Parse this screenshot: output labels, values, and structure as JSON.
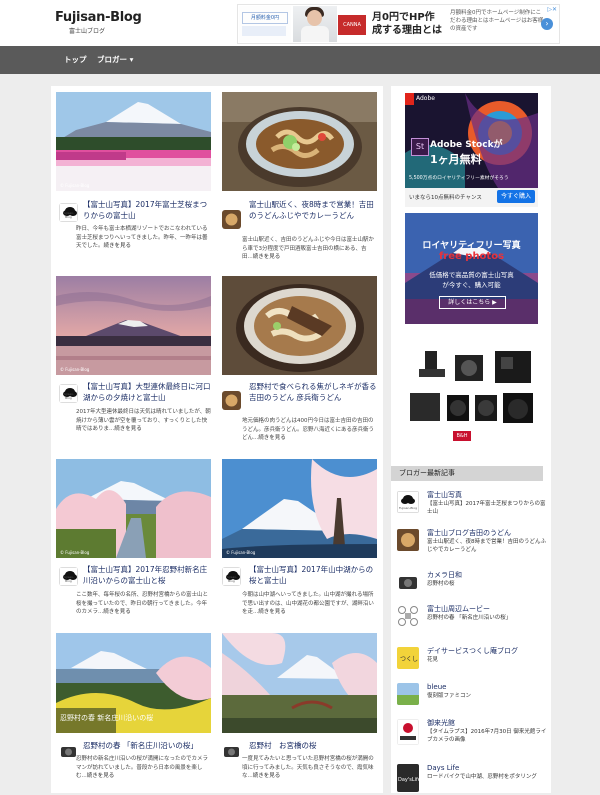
{
  "header": {
    "logo_title": "Fujisan-Blog",
    "logo_sub": "富士山ブログ",
    "ad": {
      "banner_small_label": "月額料金0円",
      "badge": "CANNA",
      "headline": "月0円でHP作成する理由とは",
      "body": "月額料金0円でホームページ制作にこだわる理由とはホームページはお客様の資産です"
    }
  },
  "nav": {
    "items": [
      {
        "label": "トップ"
      },
      {
        "label": "ブロガー ▾"
      }
    ]
  },
  "posts": [
    {
      "title": "【富士山写真】2017年富士芝桜まつりからの富士山",
      "excerpt": "昨日、今年も富士本栖湖リゾートでおこなわれている富士芝桜まつりへいってきました。昨年、一昨年は曇天でした。",
      "more": "続きを見る",
      "watermark": "© Fujisan-Blog"
    },
    {
      "title": "富士山駅近く、夜8時まで営業！吉田のうどんふじやでカレーうどん",
      "excerpt": "富士山駅近く、吉田のうどんふじや今日は富士山駅から車で3分程度で戸田酒販富士吉田の横にある、吉田...",
      "more": "続きを見る",
      "watermark": ""
    },
    {
      "title": "【富士山写真】大型連休最終日に河口湖からの夕焼けと富士山",
      "excerpt": "2017年大型連休最終日は天気は晴れていましたが、朝焼けから薄い雲が空を覆っており、すっくりとした快晴ではありま...",
      "more": "続きを見る",
      "watermark": "© Fujisan-Blog"
    },
    {
      "title": "忍野村で食べられる焦がしネギが香る吉田のうどん 彦兵衛うどん",
      "excerpt": "地元価格の肉うどんは400円今日は富士吉田の吉田のうどん。彦兵衛うどん。忍野八海近くにある彦兵衛うどん...",
      "more": "続きを見る",
      "watermark": ""
    },
    {
      "title": "【富士山写真】2017年忍野村新名庄川沿いからの富士山と桜",
      "excerpt": "ここ数年、毎年桜の名所、忍野村宮橋からの富士山と桜を撮っていたので、昨日の朝行ってきました。今年のカメラ...",
      "more": "続きを見る",
      "watermark": "© Fujisan-Blog"
    },
    {
      "title": "【富士山写真】2017年山中湖からの桜と富士山",
      "excerpt": "今朝は山中湖へいってきました。山中湖が撮れる場所で思い出すのは、山中湖花の都公園ですが、湖畔沿いを走...",
      "more": "続きを見る",
      "watermark": "© Fujisan-Blog"
    },
    {
      "title": "忍野村の春 「新名庄川沿いの桜」",
      "excerpt": "忍野村の新名庄川沿いの桜が満開になったのでカメラマンが訪れていました。普段から日本の風景を楽しむ...",
      "more": "続きを見る",
      "watermark": "忍野村の春 新名庄川沿いの桜"
    },
    {
      "title": "忍野村　お宮橋の桜",
      "excerpt": "一度見てみたいと思っていた忍野村宮橋の桜が満開の頃に行ってみました。天気も良さそうなので、霞気味な...",
      "more": "続きを見る",
      "watermark": ""
    }
  ],
  "sidebar": {
    "adobe": {
      "brand": "Adobe",
      "product": "Adobe Stockが",
      "offer": "1ヶ月無料",
      "note": "5,500万点のロイヤリティフリー素材がそろう",
      "cta_text": "いまなら10点無料のチャンス",
      "cta_button": "今すぐ購入"
    },
    "freephotos": {
      "headline": "ロイヤリティフリー写真",
      "brand": "free photos",
      "line1": "低価格で高品質の富士山写真",
      "line2": "が今すぐ、購入可能",
      "button": "詳しくはこちら ▶"
    },
    "bh": {
      "logo": "B&H"
    },
    "section_title": "ブロガー最新記事",
    "items": [
      {
        "title": "富士山写真",
        "desc": "【富士山写真】2017年富士芝桜まつりからの富士山"
      },
      {
        "title": "富士山ブログ吉田のうどん",
        "desc": "富士山駅近く、夜8時まで営業！吉田のうどんふじやでカレーうどん"
      },
      {
        "title": "カメラ日和",
        "desc": "忍野村の桜"
      },
      {
        "title": "富士山周辺ムービー",
        "desc": "忍野村の春 「新名庄川沿いの桜」"
      },
      {
        "title": "デイサービスつくし庵ブログ",
        "desc": "花見"
      },
      {
        "title": "bleue",
        "desc": "復刻版ファミコン"
      },
      {
        "title": "御来光館",
        "desc": "【タイムラプス】2016年7月30日 御来光館ライブカメラの画像"
      },
      {
        "title": "Days Life",
        "desc": "ロードバイクで山中湖、忍野村をポタリング"
      }
    ]
  },
  "colors": {
    "title_link": "#1a2c64",
    "nav_bg": "#5a5a5a",
    "page_bg": "#ededed"
  }
}
